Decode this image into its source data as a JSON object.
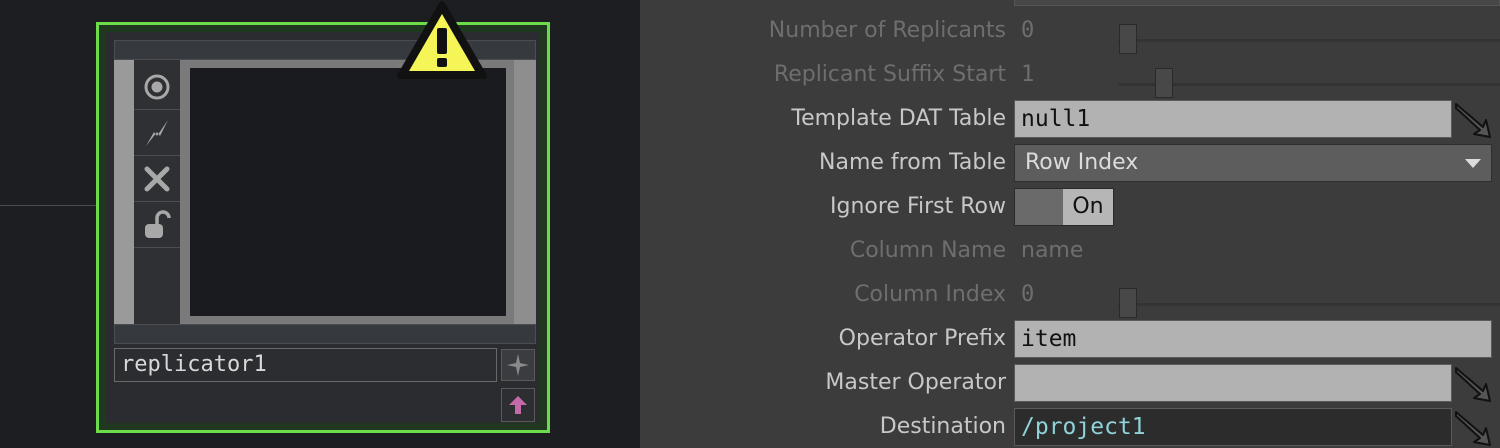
{
  "node": {
    "name": "replicator1",
    "icons": [
      "viewer-toggle-icon",
      "bypass-icon",
      "delete-icon",
      "lock-icon"
    ],
    "outline_color": "#6ddc4a",
    "warning_color": "#f5f558"
  },
  "params": {
    "num_replicants": {
      "label": "Number of Replicants",
      "value": "0",
      "slider_fraction": 0.0
    },
    "suffix_start": {
      "label": "Replicant Suffix Start",
      "value": "1",
      "slider_fraction": 0.1
    },
    "template": {
      "label": "Template DAT Table",
      "value": "null1"
    },
    "name_from_table": {
      "label": "Name from Table",
      "value": "Row Index"
    },
    "ignore_first_row": {
      "label": "Ignore First Row",
      "value": "On"
    },
    "column_name": {
      "label": "Column Name",
      "value": "name"
    },
    "column_index": {
      "label": "Column Index",
      "value": "0",
      "slider_fraction": 0.0
    },
    "op_prefix": {
      "label": "Operator Prefix",
      "value": "item"
    },
    "master_op": {
      "label": "Master Operator",
      "value": ""
    },
    "destination": {
      "label": "Destination",
      "value": "/project1"
    }
  }
}
